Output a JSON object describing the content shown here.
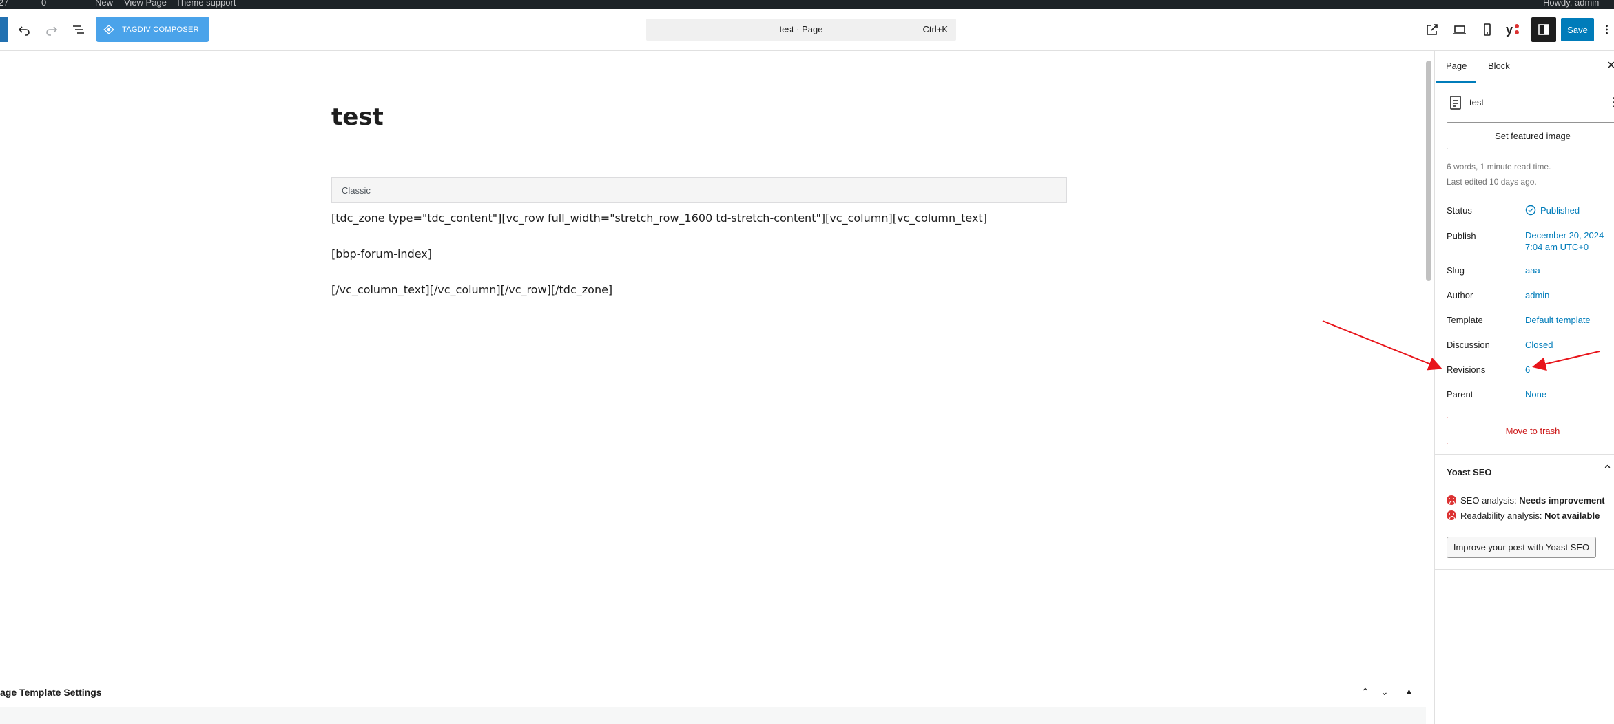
{
  "admin_bar": {
    "items": [
      "27",
      "0",
      "New",
      "View Page",
      "Theme support"
    ],
    "greeting": "Howdy, admin"
  },
  "toolbar": {
    "tagdiv_label": "TAGDIV COMPOSER",
    "command_title": "test · Page",
    "command_shortcut": "Ctrl+K",
    "save_label": "Save",
    "yoast_icon_label": "y"
  },
  "editor": {
    "title": "test",
    "classic_label": "Classic",
    "lines": [
      "[tdc_zone type=\"tdc_content\"][vc_row full_width=\"stretch_row_1600 td-stretch-content\"][vc_column][vc_column_text]",
      "[bbp-forum-index]",
      "[/vc_column_text][/vc_column][/vc_row][/tdc_zone]"
    ]
  },
  "meta_panel": {
    "title": "age Template Settings",
    "up": "⌃",
    "down": "⌄",
    "collapse": "▲"
  },
  "sidebar": {
    "tabs": [
      "Page",
      "Block"
    ],
    "close": "×",
    "doc_title": "test",
    "more": "⋮",
    "featured_label": "Set featured image",
    "words_info": "6 words, 1 minute read time.",
    "edited_info": "Last edited 10 days ago.",
    "rows": [
      {
        "label": "Status",
        "value": "Published"
      },
      {
        "label": "Publish",
        "value": "December 20, 2024",
        "value2": "7:04 am UTC+0"
      },
      {
        "label": "Slug",
        "value": "aaa"
      },
      {
        "label": "Author",
        "value": "admin"
      },
      {
        "label": "Template",
        "value": "Default template"
      },
      {
        "label": "Discussion",
        "value": "Closed"
      },
      {
        "label": "Revisions",
        "value": "6"
      },
      {
        "label": "Parent",
        "value": "None"
      }
    ],
    "trash_label": "Move to trash",
    "yoast": {
      "title": "Yoast SEO",
      "chevron": "⌃",
      "seo_prefix": "SEO analysis: ",
      "seo_value": "Needs improvement",
      "read_prefix": "Readability analysis: ",
      "read_value": "Not available",
      "improve_label": "Improve your post with Yoast SEO"
    }
  },
  "colors": {
    "accent": "#007cba",
    "tagdiv": "#4aa3ea",
    "danger": "#cc1818",
    "annotation": "#e8151b"
  }
}
